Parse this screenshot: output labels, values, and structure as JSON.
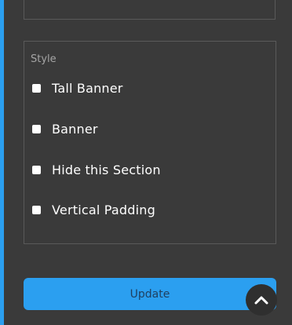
{
  "style_section": {
    "label": "Style",
    "options": [
      {
        "label": "Tall Banner",
        "checked": false
      },
      {
        "label": "Banner",
        "checked": false
      },
      {
        "label": "Hide this Section",
        "checked": false
      },
      {
        "label": "Vertical Padding",
        "checked": false
      }
    ]
  },
  "actions": {
    "update_label": "Update",
    "scroll_top_icon": "chevron-up-icon"
  },
  "colors": {
    "background": "#3a3a3a",
    "accent": "#2b9ff0",
    "panel_border": "#5a5a5a",
    "checkbox": "#ffffff",
    "scroll_button": "#2f2f2f"
  }
}
